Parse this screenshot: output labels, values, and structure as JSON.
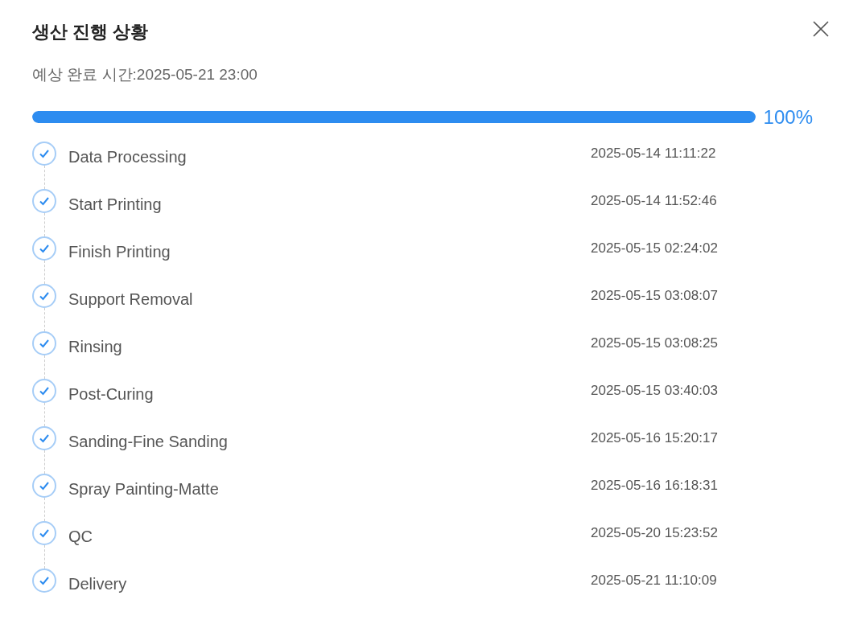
{
  "dialog": {
    "title": "생산 진행 상황",
    "subtitle": "예상 완료 시간:2025-05-21 23:00"
  },
  "progress": {
    "level": 1,
    "reading": "100%"
  },
  "steps": [
    {
      "label": "Data Processing",
      "time": "2025-05-14 11:11:22",
      "done": true
    },
    {
      "label": "Start Printing",
      "time": "2025-05-14 11:52:46",
      "done": true
    },
    {
      "label": "Finish Printing",
      "time": "2025-05-15 02:24:02",
      "done": true
    },
    {
      "label": "Support Removal",
      "time": "2025-05-15 03:08:07",
      "done": true
    },
    {
      "label": "Rinsing",
      "time": "2025-05-15 03:08:25",
      "done": true
    },
    {
      "label": "Post-Curing",
      "time": "2025-05-15 03:40:03",
      "done": true
    },
    {
      "label": "Sanding-Fine Sanding",
      "time": "2025-05-16 15:20:17",
      "done": true
    },
    {
      "label": "Spray Painting-Matte",
      "time": "2025-05-16 16:18:31",
      "done": true
    },
    {
      "label": "QC",
      "time": "2025-05-20 15:23:52",
      "done": true
    },
    {
      "label": "Delivery",
      "time": "2025-05-21 11:10:09",
      "done": true
    }
  ]
}
